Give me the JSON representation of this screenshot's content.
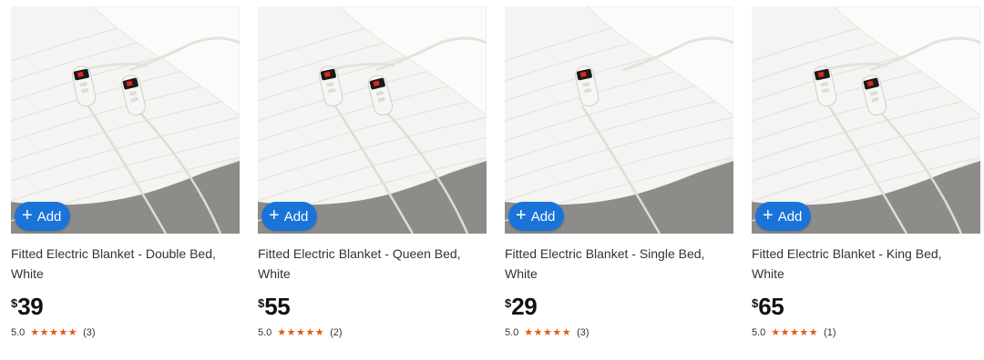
{
  "products": [
    {
      "title_line1": "Fitted Electric Blanket - Double Bed,",
      "title_line2": "White",
      "currency": "$",
      "price": "39",
      "rating": "5.0",
      "stars": "★★★★★",
      "review_count": "(3)",
      "add_label": "Add",
      "add_icon": "plus-icon",
      "controllers": 2
    },
    {
      "title_line1": "Fitted Electric Blanket - Queen Bed,",
      "title_line2": "White",
      "currency": "$",
      "price": "55",
      "rating": "5.0",
      "stars": "★★★★★",
      "review_count": "(2)",
      "add_label": "Add",
      "add_icon": "plus-icon",
      "controllers": 2
    },
    {
      "title_line1": "Fitted Electric Blanket - Single Bed,",
      "title_line2": "White",
      "currency": "$",
      "price": "29",
      "rating": "5.0",
      "stars": "★★★★★",
      "review_count": "(3)",
      "add_label": "Add",
      "add_icon": "plus-icon",
      "controllers": 1
    },
    {
      "title_line1": "Fitted Electric Blanket - King Bed,",
      "title_line2": "White",
      "currency": "$",
      "price": "65",
      "rating": "5.0",
      "stars": "★★★★★",
      "review_count": "(1)",
      "add_label": "Add",
      "add_icon": "plus-icon",
      "controllers": 2
    }
  ],
  "colors": {
    "add_button": "#1a73d8",
    "star": "#e05a17",
    "price_text": "#111111",
    "body_text": "#333333"
  }
}
